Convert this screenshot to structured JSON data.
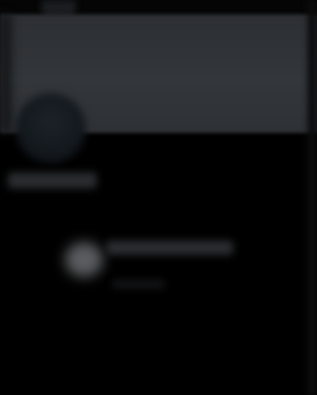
{
  "profile": {
    "name": "",
    "banner_color": "#313438",
    "avatar_color": "#151a1f"
  },
  "empty_state": {
    "title": "",
    "subtitle": "",
    "icon": "placeholder-icon"
  },
  "colors": {
    "background": "#000000",
    "surface": "#2a2c2f"
  }
}
